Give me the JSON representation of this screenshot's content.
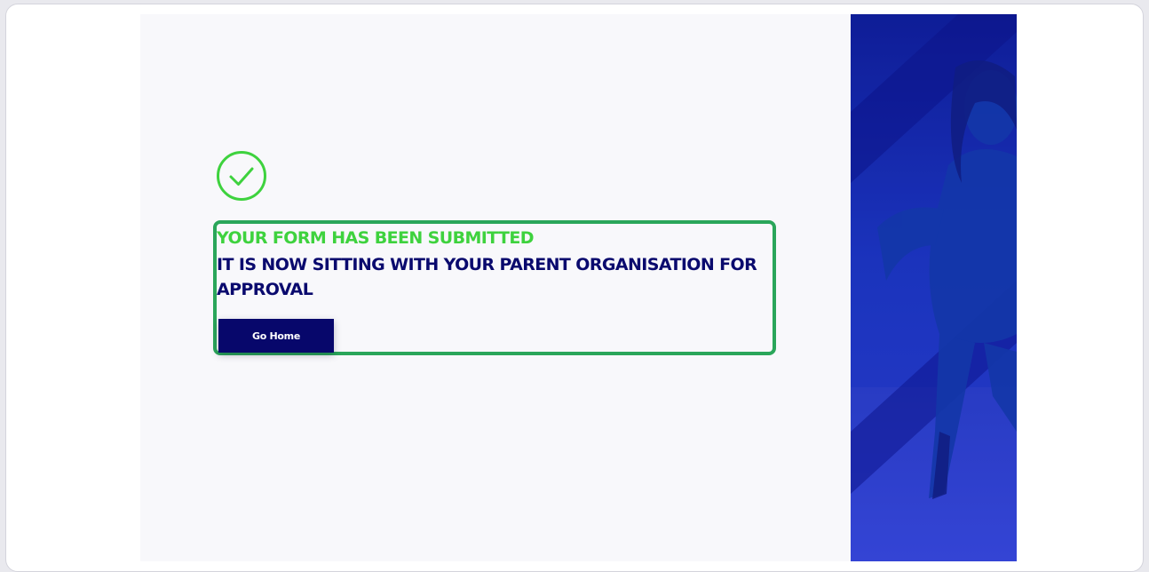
{
  "confirmation": {
    "title": "YOUR FORM HAS BEEN SUBMITTED",
    "message": "IT IS NOW SITTING WITH YOUR PARENT ORGANISATION FOR APPROVAL",
    "go_home_label": "Go Home"
  },
  "icons": {
    "success": "check-circle-icon"
  },
  "colors": {
    "success_green": "#3ed23e",
    "brand_navy": "#0a0a6e",
    "button_navy": "#07076b",
    "highlight_green": "#2aa65a",
    "hero_blue": "#1a2fb0"
  }
}
